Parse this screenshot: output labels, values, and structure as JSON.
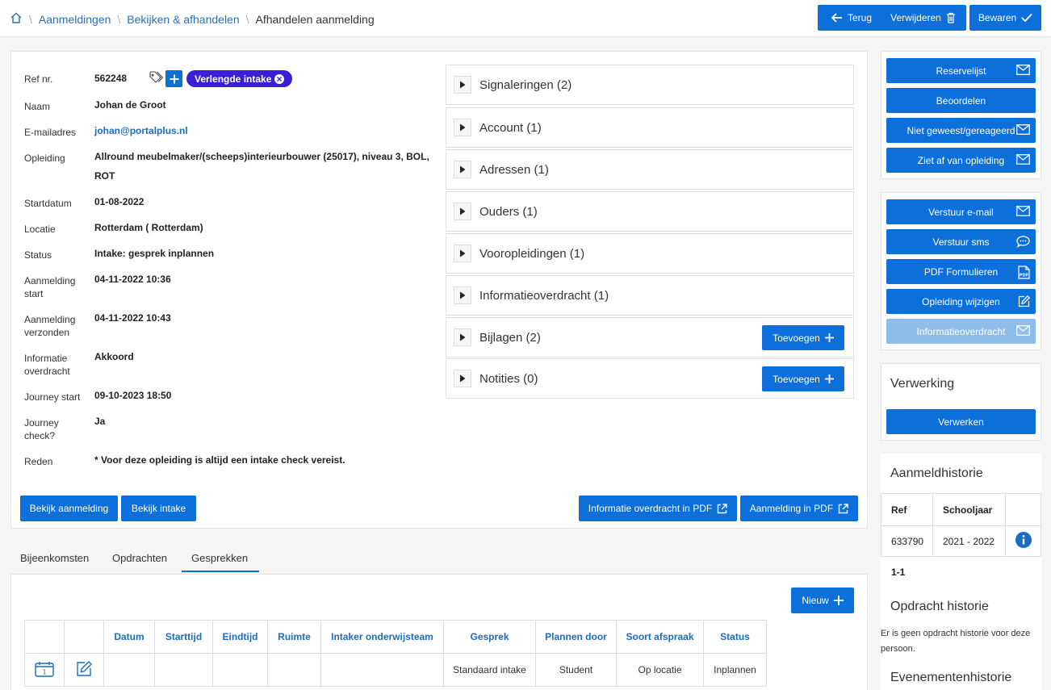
{
  "breadcrumb": {
    "items": [
      "Aanmeldingen",
      "Bekijken & afhandelen"
    ],
    "current": "Afhandelen aanmelding"
  },
  "toolbar": {
    "back_label": "Terug",
    "delete_label": "Verwijderen",
    "save_label": "Bewaren"
  },
  "details": {
    "ref_label": "Ref nr.",
    "ref_value": "562248",
    "tag_label": "Verlengde intake",
    "rows": [
      {
        "label": "Naam",
        "value": "Johan de Groot"
      },
      {
        "label": "E-mailadres",
        "value": "johan@portalplus.nl"
      },
      {
        "label": "Opleiding",
        "value": "Allround meubelmaker/(scheeps)interieurbouwer (25017), niveau 3, BOL,",
        "value2": "ROT"
      },
      {
        "label": "Startdatum",
        "value": "01-08-2022"
      },
      {
        "label": "Locatie",
        "value": "Rotterdam ( Rotterdam)"
      },
      {
        "label": "Status",
        "value": "Intake: gesprek inplannen"
      },
      {
        "label": "Aanmelding",
        "label2": "start",
        "value": "04-11-2022 10:36"
      },
      {
        "label": "Aanmelding",
        "label2": "verzonden",
        "value": "04-11-2022 10:43"
      },
      {
        "label": "Informatie",
        "label2": "overdracht",
        "value": "Akkoord"
      },
      {
        "label": "Journey start",
        "value": "09-10-2023 18:50"
      },
      {
        "label": "Journey",
        "label2": "check?",
        "value": "Ja"
      },
      {
        "label": "Reden",
        "value": "* Voor deze opleiding is altijd een intake check vereist."
      }
    ],
    "btn_bekijk_aanmelding": "Bekijk aanmelding",
    "btn_bekijk_intake": "Bekijk intake",
    "btn_info_pdf": "Informatie overdracht in PDF",
    "btn_aanmelding_pdf": "Aanmelding in PDF"
  },
  "accordion": [
    {
      "title": "Signaleringen (2)"
    },
    {
      "title": "Account (1)"
    },
    {
      "title": "Adressen (1)"
    },
    {
      "title": "Ouders (1)"
    },
    {
      "title": "Vooropleidingen (1)"
    },
    {
      "title": "Informatieoverdracht (1)"
    },
    {
      "title": "Bijlagen (2)",
      "button": "Toevoegen"
    },
    {
      "title": "Notities (0)",
      "button": "Toevoegen"
    }
  ],
  "tabs": [
    "Bijeenkomsten",
    "Opdrachten",
    "Gesprekken"
  ],
  "active_tab": "Gesprekken",
  "gesprekken": {
    "new_label": "Nieuw",
    "columns": [
      "Datum",
      "Starttijd",
      "Eindtijd",
      "Ruimte",
      "Intaker onderwijsteam",
      "Gesprek",
      "Plannen door",
      "Soort afspraak",
      "Status"
    ],
    "rows": [
      {
        "Datum": "",
        "Starttijd": "",
        "Eindtijd": "",
        "Ruimte": "",
        "Intaker": "",
        "Gesprek": "Standaard intake",
        "Plannen": "Student",
        "Soort": "Op locatie",
        "Status": "Inplannen"
      }
    ]
  },
  "sidebar": {
    "group1": [
      "Reservelijst",
      "Beoordelen",
      "Niet geweest/gereageerd",
      "Ziet af van opleiding"
    ],
    "group2": [
      "Verstuur e-mail",
      "Verstuur sms",
      "PDF Formulieren",
      "Opleiding wijzigen",
      "Informatieoverdracht"
    ],
    "verwerking_title": "Verwerking",
    "verwerken_label": "Verwerken",
    "historie_title": "Aanmeldhistorie",
    "historie_cols": [
      "Ref",
      "Schooljaar"
    ],
    "historie_rows": [
      {
        "ref": "633790",
        "year": "2021 - 2022"
      }
    ],
    "historie_paging": "1-1",
    "opdracht_title": "Opdracht historie",
    "opdracht_empty": "Er is geen opdracht historie voor deze persoon.",
    "events_title": "Evenementenhistorie"
  },
  "colors": {
    "primary": "#0d6fd9",
    "tag": "#3a1fd9",
    "link": "#2a6fb8"
  }
}
